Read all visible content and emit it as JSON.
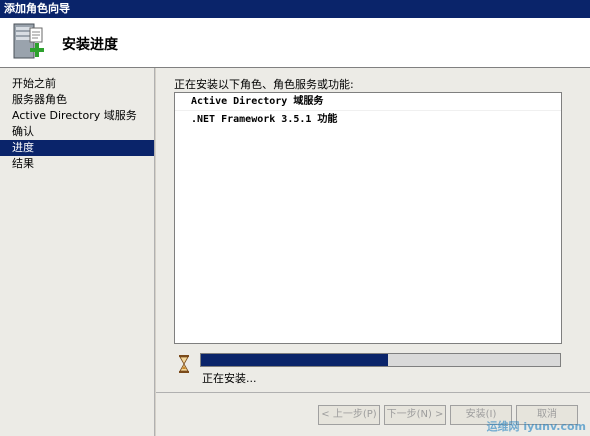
{
  "window": {
    "title": "添加角色向导"
  },
  "header": {
    "title": "安装进度"
  },
  "sidebar": {
    "items": [
      {
        "label": "开始之前"
      },
      {
        "label": "服务器角色"
      },
      {
        "label": "Active Directory 域服务"
      },
      {
        "label": "确认"
      },
      {
        "label": "进度"
      },
      {
        "label": "结果"
      }
    ]
  },
  "main": {
    "label": "正在安装以下角色、角色服务或功能:",
    "list_items": [
      "Active Directory 域服务",
      ".NET Framework 3.5.1 功能"
    ],
    "progress_percent": 52,
    "status": "正在安装..."
  },
  "buttons": {
    "prev": "< 上一步(P)",
    "next": "下一步(N) >",
    "install": "安装(I)",
    "cancel": "取消"
  },
  "watermark": {
    "text": "运维网 iyunv.com"
  }
}
